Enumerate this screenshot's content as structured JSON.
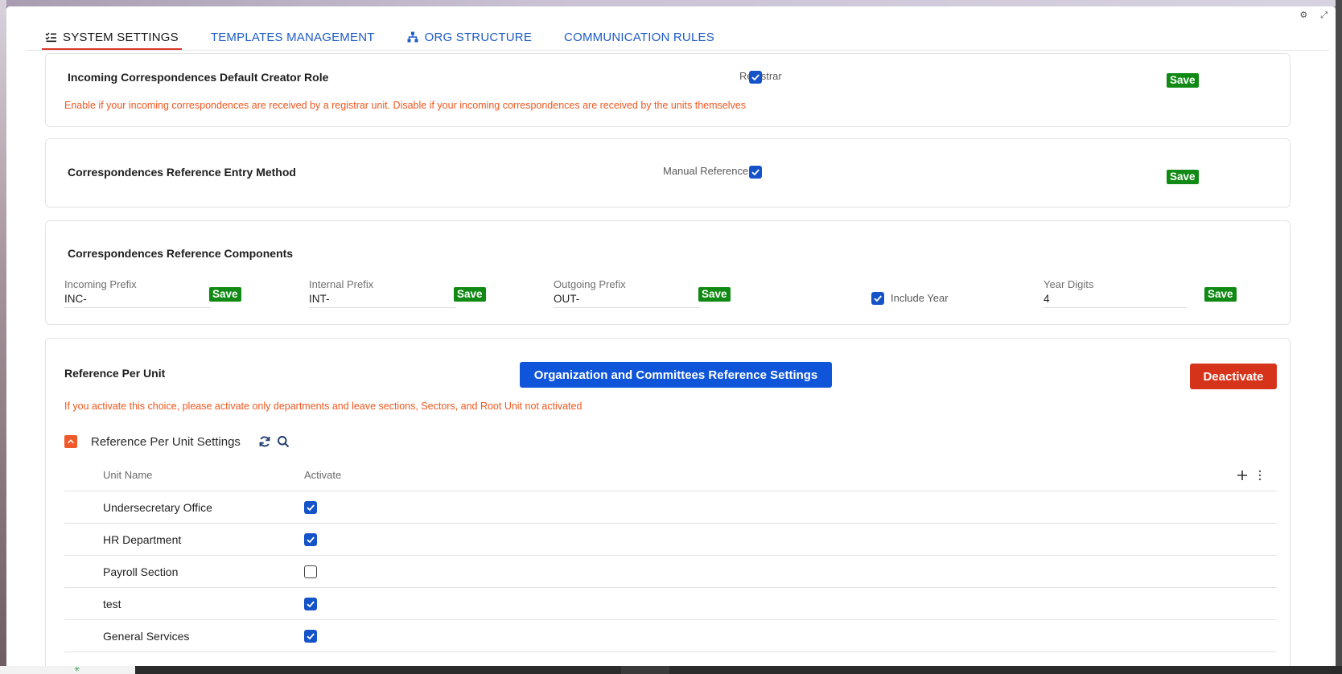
{
  "tabs": [
    {
      "label": "SYSTEM SETTINGS",
      "icon": "checklist-icon"
    },
    {
      "label": "TEMPLATES MANAGEMENT",
      "icon": ""
    },
    {
      "label": "ORG STRUCTURE",
      "icon": "org-chart-icon"
    },
    {
      "label": "COMMUNICATION RULES",
      "icon": ""
    }
  ],
  "window_controls": {
    "settings": "⚙",
    "expand": "⤢"
  },
  "default_creator": {
    "title": "Incoming Correspondences Default Creator Role",
    "checkbox_label": "Registrar",
    "checked": true,
    "save_label": "Save",
    "note": "Enable if your incoming correspondences are received by a registrar unit. Disable if your incoming correspondences are received by the units themselves"
  },
  "entry_method": {
    "title": "Correspondences Reference Entry Method",
    "checkbox_label": "Manual Reference",
    "checked": true,
    "save_label": "Save"
  },
  "components": {
    "title": "Correspondences Reference Components",
    "incoming": {
      "label": "Incoming Prefix",
      "value": "INC-"
    },
    "internal": {
      "label": "Internal Prefix",
      "value": "INT-"
    },
    "outgoing": {
      "label": "Outgoing Prefix",
      "value": "OUT-"
    },
    "include_year": {
      "label": "Include Year",
      "checked": true
    },
    "year_digits": {
      "label": "Year Digits",
      "value": "4"
    },
    "save_label": "Save"
  },
  "per_unit": {
    "title": "Reference Per Unit",
    "org_button": "Organization and Committees Reference Settings",
    "deactivate_button": "Deactivate",
    "note": "If you activate this choice, please activate only departments and leave sections, Sectors, and Root Unit not activated",
    "settings_title": "Reference Per Unit Settings",
    "columns": {
      "unit_name": "Unit Name",
      "activate": "Activate"
    },
    "rows": [
      {
        "name": "Undersecretary Office",
        "active": true
      },
      {
        "name": "HR Department",
        "active": true
      },
      {
        "name": "Payroll Section",
        "active": false
      },
      {
        "name": "test",
        "active": true
      },
      {
        "name": "General Services",
        "active": true
      }
    ]
  },
  "colors": {
    "accent_blue": "#0f55d9",
    "save_green": "#108a14",
    "note_orange": "#f0571f",
    "deactivate_red": "#d6341a"
  }
}
